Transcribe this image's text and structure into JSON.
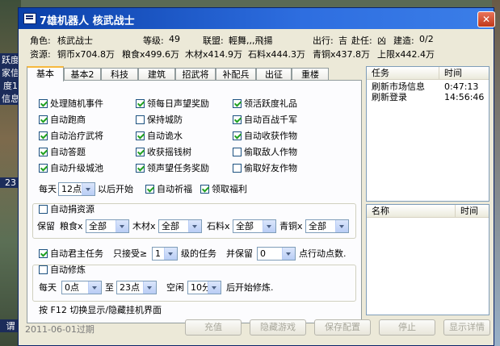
{
  "background": {
    "side_texts": [
      "跃度",
      "家信",
      "度1",
      "信息",
      "23",
      "谓"
    ]
  },
  "window": {
    "title": "7雄机器人  核武战士",
    "close": "✕"
  },
  "info1": {
    "role_label": "角色:",
    "role": "核武战士",
    "level_label": "等级:",
    "level": "49",
    "alliance_label": "联盟:",
    "alliance": "輕舞,,,飛揚",
    "travel_label": "出行:",
    "travel": "吉",
    "goto_label": "赴任:",
    "goto": "凶",
    "build_label": "建造:",
    "build": "0/2"
  },
  "info2": {
    "res_label": "资源:",
    "copper_coin": "铜币x704.8万",
    "grain": "粮食x499.6万",
    "wood": "木材x414.9万",
    "stone": "石料x444.3万",
    "bronze": "青铜x437.8万",
    "limit": "上限x442.4万"
  },
  "tabs": [
    "基本",
    "基本2",
    "科技",
    "建筑",
    "招武将",
    "补配兵",
    "出征",
    "重楼"
  ],
  "checks": [
    {
      "label": "处理随机事件",
      "checked": true
    },
    {
      "label": "领每日声望奖励",
      "checked": true
    },
    {
      "label": "领活跃度礼品",
      "checked": true
    },
    {
      "label": "自动跑商",
      "checked": true
    },
    {
      "label": "保持城防",
      "checked": false
    },
    {
      "label": "自动百战千军",
      "checked": true
    },
    {
      "label": "自动治疗武将",
      "checked": true
    },
    {
      "label": "自动诡水",
      "checked": true
    },
    {
      "label": "自动收获作物",
      "checked": true
    },
    {
      "label": "自动答题",
      "checked": true
    },
    {
      "label": "收获摇钱树",
      "checked": true
    },
    {
      "label": "偷取敌人作物",
      "checked": false
    },
    {
      "label": "自动升级城池",
      "checked": true
    },
    {
      "label": "领声望任务奖励",
      "checked": true
    },
    {
      "label": "偷取好友作物",
      "checked": false
    }
  ],
  "daily": {
    "prefix": "每天",
    "hour": "12点",
    "suffix": "以后开始",
    "pray": {
      "label": "自动祈福",
      "checked": true
    },
    "welfare": {
      "label": "领取福利",
      "checked": true
    }
  },
  "donate": {
    "label": "自动捐资源",
    "checked": false,
    "keep": "保留",
    "grain": "粮食x",
    "wood": "木材x",
    "stone": "石料x",
    "bronze": "青铜x",
    "all": "全部"
  },
  "lord": {
    "label": "自动君主任务",
    "checked": true,
    "accept": "只接受≥",
    "level": "1",
    "suffix1": "级的任务",
    "keep": "并保留",
    "points": "0",
    "suffix2": "点行动点数."
  },
  "cultivate": {
    "label": "自动修炼",
    "checked": false,
    "prefix": "每天",
    "start": "0点",
    "to": "至",
    "end": "23点",
    "idle": "空闲",
    "minutes": "10分",
    "suffix": "后开始修炼."
  },
  "hint": "按 F12 切换显示/隐藏挂机界面",
  "task_list": {
    "col1": "任务",
    "col2": "时间",
    "rows": [
      {
        "task": "刷新市场信息",
        "time": "0:47:13"
      },
      {
        "task": "刷新登录",
        "time": "14:56:46"
      }
    ]
  },
  "name_list": {
    "col1": "名称",
    "col2": "时间"
  },
  "footer": {
    "expired": "2011-06-01过期",
    "recharge": "充值",
    "hide_game": "隐藏游戏",
    "save_config": "保存配置",
    "stop": "停止",
    "details": "显示详情"
  }
}
